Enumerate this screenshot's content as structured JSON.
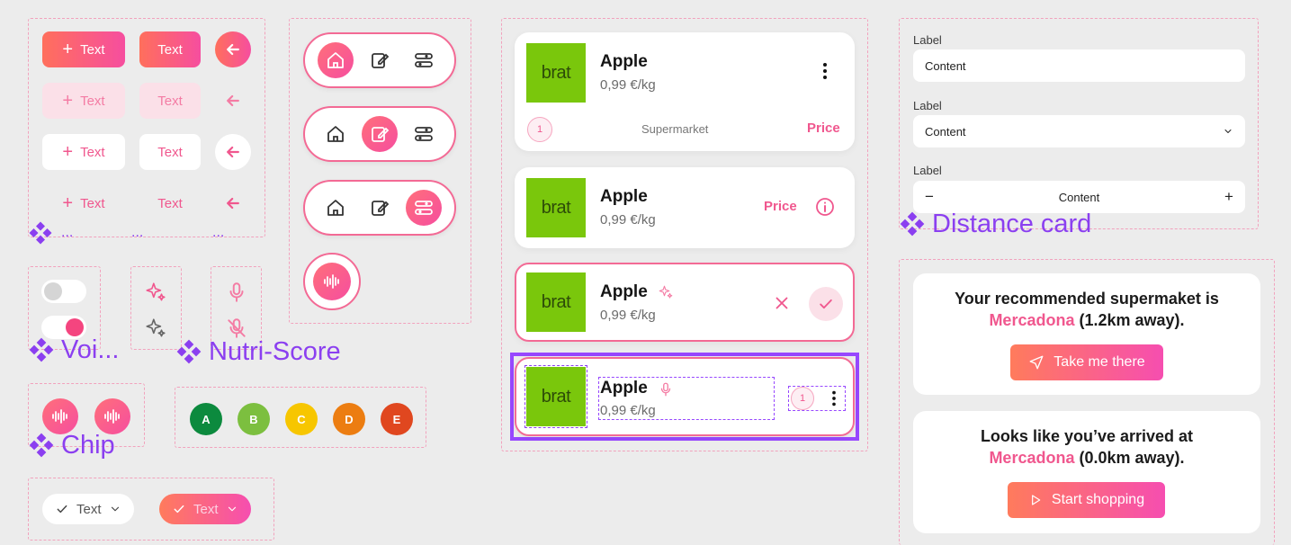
{
  "buttons": {
    "text": "Text"
  },
  "labels": {
    "voice": "Voi...",
    "nutri": "Nutri-Score",
    "chip": "Chip",
    "distance": "Distance card",
    "dots": "..."
  },
  "products": {
    "logo": "brat",
    "name": "Apple",
    "price": "0,99 €/kg",
    "price_label": "Price",
    "store": "Supermarket",
    "qty": "1"
  },
  "form": {
    "label1": "Label",
    "value1": "Content",
    "label2": "Label",
    "value2": "Content",
    "label3": "Label",
    "value3": "Content",
    "minus": "−",
    "plus": "+"
  },
  "nutriscore": {
    "grades": [
      "A",
      "B",
      "C",
      "D",
      "E"
    ],
    "colors": [
      "#0c8a3e",
      "#7cbf3f",
      "#f7c600",
      "#ec7d11",
      "#e0471f"
    ]
  },
  "distance": {
    "card1": {
      "prefix": "Your recommended supermaket is",
      "store": "Mercadona",
      "suffix": "(1.2km away).",
      "button": "Take me there"
    },
    "card2": {
      "prefix": "Looks like you’ve arrived at",
      "store": "Mercadona",
      "suffix": "(0.0km away).",
      "button": "Start shopping"
    }
  },
  "filters": {
    "chip1": "Text",
    "chip2": "Text"
  },
  "colors": {
    "accent": "#f0578e",
    "frame": "#8b3ff0",
    "brat": "#7ac70c"
  }
}
